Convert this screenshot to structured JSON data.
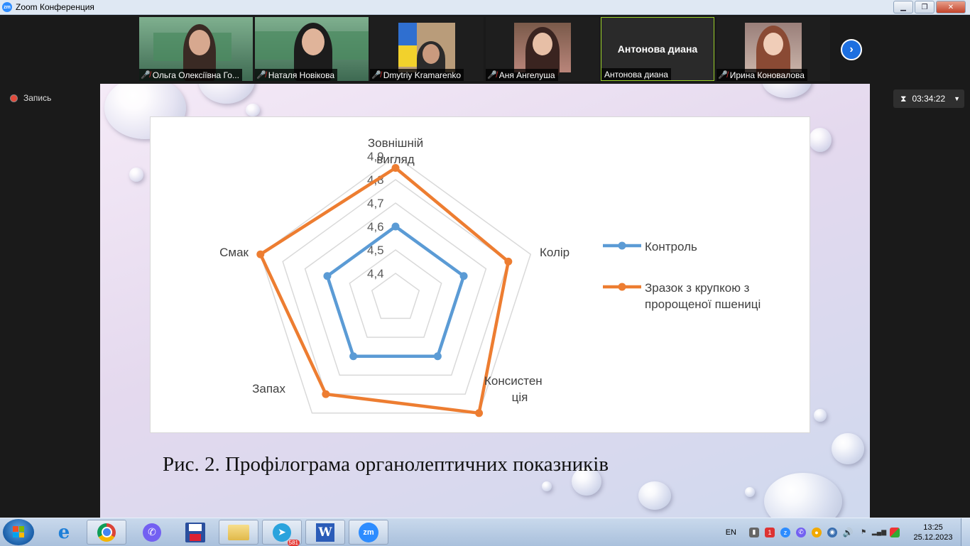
{
  "window": {
    "title": "Zoom Конференция",
    "app_badge": "zm"
  },
  "participants": [
    {
      "name": "Ольга Олексіївна Го...",
      "muted": true
    },
    {
      "name": "Наталя Новікова",
      "muted": true
    },
    {
      "name": "Dmytriy Kramarenko",
      "muted": true
    },
    {
      "name": "Аня Ангелуша",
      "muted": true
    },
    {
      "name": "Антонова диана",
      "muted": false,
      "video_off_label": "Антонова диана"
    },
    {
      "name": "Ирина Коновалова",
      "muted": true
    }
  ],
  "recording": {
    "label": "Запись"
  },
  "timer": {
    "value": "03:34:22"
  },
  "slide": {
    "caption": "Рис. 2. Профілограма органолептичних показників"
  },
  "chart_data": {
    "type": "radar",
    "axes": [
      "Зовнішній вигляд",
      "Колір",
      "Консистенція",
      "Запах",
      "Смак"
    ],
    "axis_labels": [
      [
        "Зовнішній",
        "вигляд"
      ],
      [
        "Колір"
      ],
      [
        "Консистен",
        "ція"
      ],
      [
        "Запах"
      ],
      [
        "Смак"
      ]
    ],
    "scale_ticks": [
      "4,4",
      "4,5",
      "4,6",
      "4,7",
      "4,8",
      "4,9"
    ],
    "rlim": [
      4.4,
      4.9
    ],
    "series": [
      {
        "name": "Контроль",
        "color": "#5b9bd5",
        "values": [
          4.6,
          4.6,
          4.6,
          4.6,
          4.6
        ]
      },
      {
        "name": "Зразок з крупкою з пророщеної пшениці",
        "legend_lines": [
          "Зразок з крупкою з",
          "пророщеної пшениці"
        ],
        "color": "#ed7d31",
        "values": [
          4.85,
          4.8,
          4.9,
          4.8,
          4.9
        ]
      }
    ],
    "legend": "right",
    "grid": true
  },
  "taskbar": {
    "apps": [
      "Windows Start",
      "Internet Explorer",
      "Google Chrome",
      "Viber",
      "Save",
      "Explorer",
      "Telegram",
      "Word",
      "Zoom"
    ],
    "telegram_badge": "581",
    "zoom_label": "zm",
    "language": "EN",
    "time": "13:25",
    "date": "25.12.2023"
  }
}
